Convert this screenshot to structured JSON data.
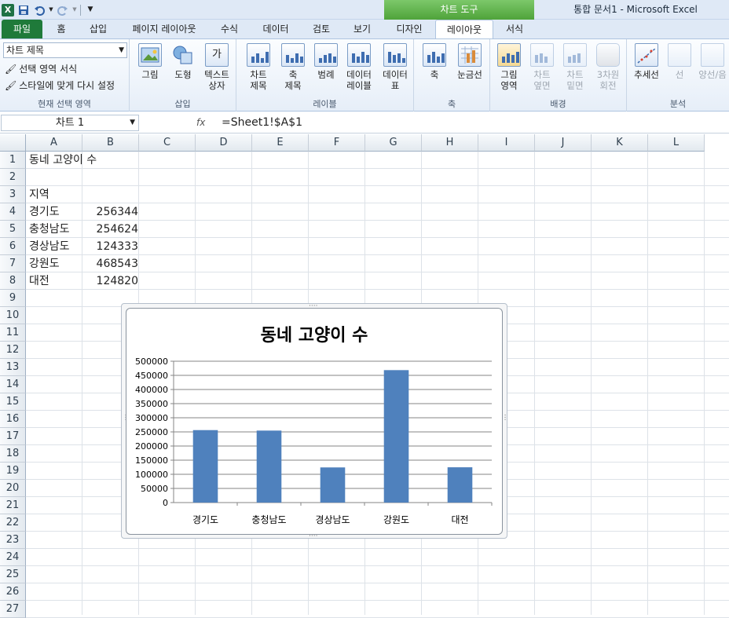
{
  "titlebar": {
    "qat_icons": [
      "excel-logo-icon",
      "save-icon",
      "undo-icon",
      "redo-icon",
      "customize-icon"
    ],
    "context_tool_title": "차트 도구",
    "window_title": "통합 문서1  -  Microsoft Excel"
  },
  "tabs": [
    {
      "label": "파일"
    },
    {
      "label": "홈"
    },
    {
      "label": "삽입"
    },
    {
      "label": "페이지 레이아웃"
    },
    {
      "label": "수식"
    },
    {
      "label": "데이터"
    },
    {
      "label": "검토"
    },
    {
      "label": "보기"
    },
    {
      "label": "디자인"
    },
    {
      "label": "레이아웃"
    },
    {
      "label": "서식"
    }
  ],
  "ribbon": {
    "current_selection": {
      "dropdown_value": "차트 제목",
      "format_selection": "선택 영역 서식",
      "reset_style": "스타일에 맞게 다시 설정",
      "group_label": "현재 선택 영역"
    },
    "insert": {
      "picture": "그림",
      "shapes": "도형",
      "textbox_1": "텍스트",
      "textbox_2": "상자",
      "group_label": "삽입"
    },
    "labels": {
      "chart_title_1": "차트",
      "chart_title_2": "제목",
      "axis_title_1": "축",
      "axis_title_2": "제목",
      "legend_1": "범례",
      "data_labels_1": "데이터",
      "data_labels_2": "레이블",
      "data_table_1": "데이터",
      "data_table_2": "표",
      "group_label": "레이블"
    },
    "axes": {
      "axes": "축",
      "gridlines": "눈금선",
      "group_label": "축"
    },
    "background": {
      "plot_area_1": "그림",
      "plot_area_2": "영역",
      "wall_1": "차트",
      "wall_2": "옆면",
      "floor_1": "차트",
      "floor_2": "밑면",
      "rotation_1": "3차원",
      "rotation_2": "회전",
      "group_label": "배경"
    },
    "analysis": {
      "trendline": "추세선",
      "lines": "선",
      "updown_1": "양선/음",
      "group_label": "분석"
    }
  },
  "formula_bar": {
    "name_box": "차트 1",
    "fx_label": "fx",
    "formula": "=Sheet1!$A$1"
  },
  "sheet": {
    "columns": [
      "A",
      "B",
      "C",
      "D",
      "E",
      "F",
      "G",
      "H",
      "I",
      "J",
      "K",
      "L"
    ],
    "rows": [
      "1",
      "2",
      "3",
      "4",
      "5",
      "6",
      "7",
      "8",
      "9",
      "10",
      "11",
      "12",
      "13",
      "14",
      "15",
      "16",
      "17",
      "18",
      "19",
      "20",
      "21",
      "22",
      "23",
      "24",
      "25",
      "26",
      "27"
    ],
    "cells": {
      "a1": "동네 고양이 수",
      "a3": "지역",
      "a4": "경기도",
      "b4": "256344",
      "a5": "충청남도",
      "b5": "254624",
      "a6": "경상남도",
      "b6": "124333",
      "a7": "강원도",
      "b7": "468543",
      "a8": "대전",
      "b8": "124820"
    }
  },
  "chart_data": {
    "type": "bar",
    "title": "동네 고양이 수",
    "categories": [
      "경기도",
      "충청남도",
      "경상남도",
      "강원도",
      "대전"
    ],
    "values": [
      256344,
      254624,
      124333,
      468543,
      124820
    ],
    "ylim": [
      0,
      500000
    ],
    "yticks": [
      "0",
      "50000",
      "100000",
      "150000",
      "200000",
      "250000",
      "300000",
      "350000",
      "400000",
      "450000",
      "500000"
    ],
    "bar_color": "#4f81bd",
    "grid": true,
    "legend": "none"
  }
}
